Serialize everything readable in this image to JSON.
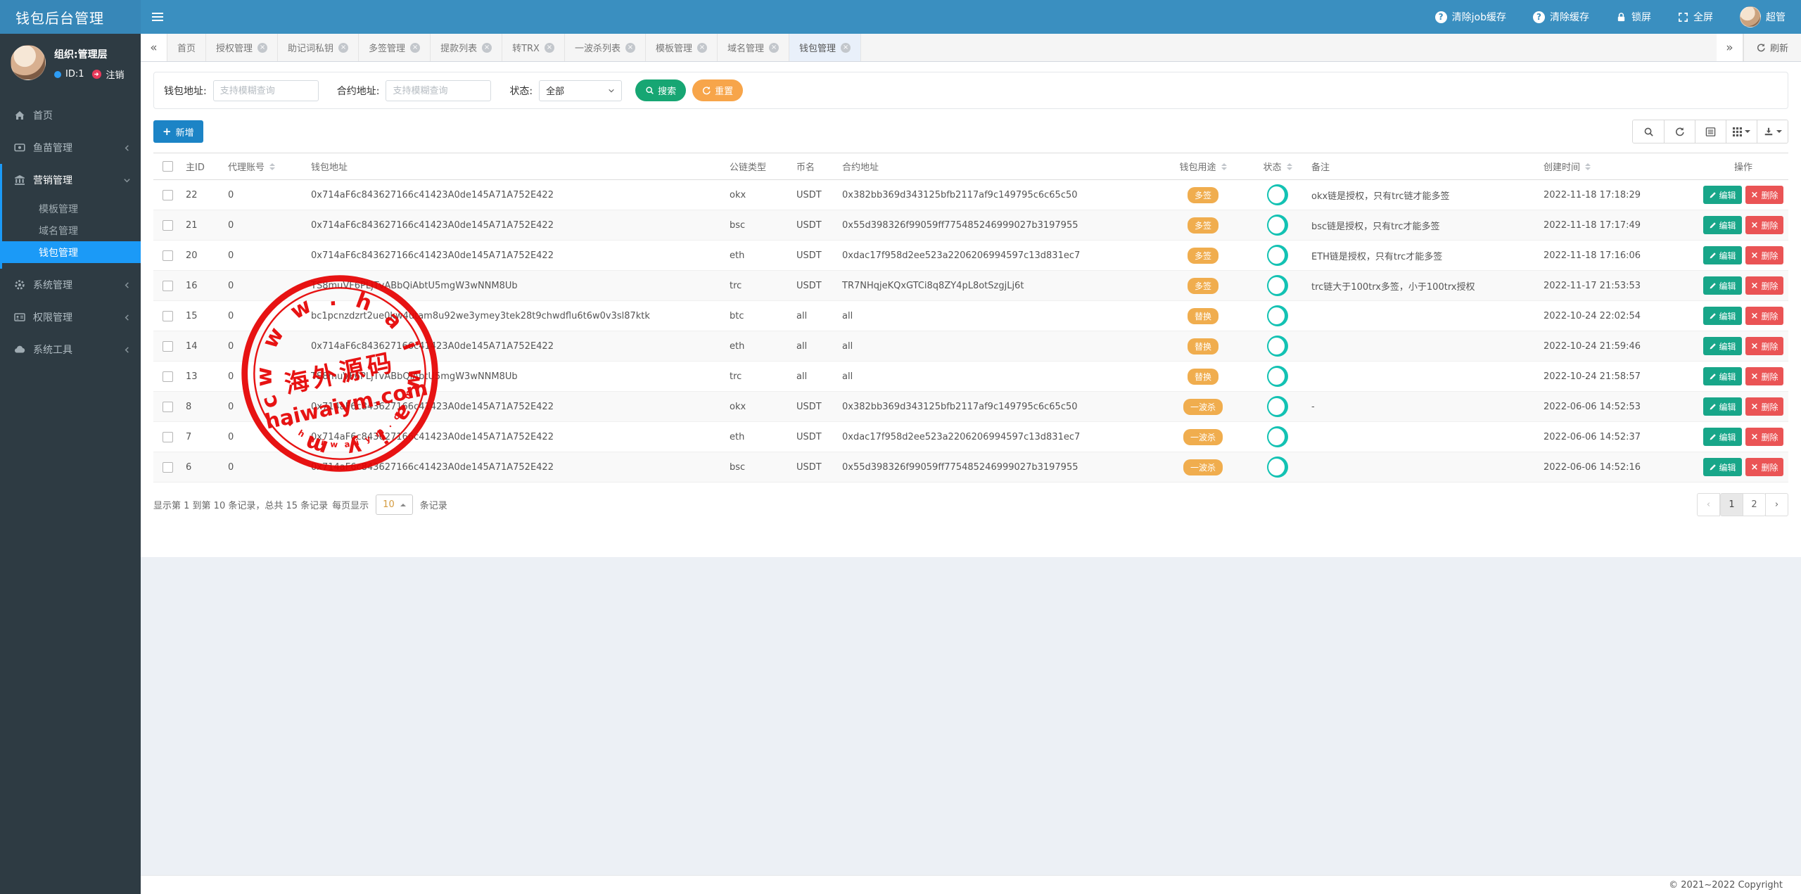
{
  "app": {
    "title": "钱包后台管理"
  },
  "topbar": {
    "actions": [
      {
        "name": "clear-job-cache-button",
        "icon": "question-icon",
        "label": "清除job缓存"
      },
      {
        "name": "clear-cache-button",
        "icon": "question-icon",
        "label": "清除缓存"
      },
      {
        "name": "lock-screen-button",
        "icon": "lock-icon",
        "label": "锁屏"
      },
      {
        "name": "fullscreen-button",
        "icon": "fullscreen-icon",
        "label": "全屏"
      }
    ],
    "user": {
      "label": "超管"
    }
  },
  "tabbar": {
    "scroll_left": "«",
    "scroll_right": "»",
    "refresh_label": "刷新",
    "tabs": [
      {
        "label": "首页",
        "closable": false,
        "active": false
      },
      {
        "label": "授权管理",
        "closable": true,
        "active": false
      },
      {
        "label": "助记词私钥",
        "closable": true,
        "active": false
      },
      {
        "label": "多签管理",
        "closable": true,
        "active": false
      },
      {
        "label": "提款列表",
        "closable": true,
        "active": false
      },
      {
        "label": "转TRX",
        "closable": true,
        "active": false
      },
      {
        "label": "一波杀列表",
        "closable": true,
        "active": false
      },
      {
        "label": "模板管理",
        "closable": true,
        "active": false
      },
      {
        "label": "域名管理",
        "closable": true,
        "active": false
      },
      {
        "label": "钱包管理",
        "closable": true,
        "active": true
      }
    ]
  },
  "sidebar": {
    "user": {
      "org": "组织:管理层",
      "id": "ID:1",
      "logout": "注销"
    },
    "menu": [
      {
        "label": "首页",
        "icon": "home-icon",
        "chevron": null
      },
      {
        "label": "鱼苗管理",
        "icon": "screen-icon",
        "chevron": "left"
      },
      {
        "label": "营销管理",
        "icon": "bank-icon",
        "chevron": "down",
        "active_section": true,
        "children": [
          {
            "label": "模板管理",
            "active": false
          },
          {
            "label": "域名管理",
            "active": false
          },
          {
            "label": "钱包管理",
            "active": true
          }
        ]
      },
      {
        "label": "系统管理",
        "icon": "gear-icon",
        "chevron": "left"
      },
      {
        "label": "权限管理",
        "icon": "idcard-icon",
        "chevron": "left"
      },
      {
        "label": "系统工具",
        "icon": "cloud-icon",
        "chevron": "left"
      }
    ]
  },
  "search": {
    "wallet_label": "钱包地址:",
    "wallet_placeholder": "支持模糊查询",
    "contract_label": "合约地址:",
    "contract_placeholder": "支持模糊查询",
    "status_label": "状态:",
    "status_value": "全部",
    "search_label": "搜索",
    "reset_label": "重置"
  },
  "toolbar": {
    "add_label": "新增",
    "icons": [
      "search-icon",
      "refresh-icon",
      "detail-view-icon",
      "columns-icon",
      "export-icon"
    ]
  },
  "table": {
    "columns": [
      {
        "key": "sel",
        "label": "",
        "checkbox": true
      },
      {
        "key": "id",
        "label": "主ID"
      },
      {
        "key": "agent",
        "label": "代理账号",
        "sortable": true
      },
      {
        "key": "addr",
        "label": "钱包地址"
      },
      {
        "key": "chain",
        "label": "公链类型"
      },
      {
        "key": "coin",
        "label": "币名"
      },
      {
        "key": "contract",
        "label": "合约地址"
      },
      {
        "key": "usage",
        "label": "钱包用途",
        "sortable": true
      },
      {
        "key": "status",
        "label": "状态",
        "sortable": true
      },
      {
        "key": "remark",
        "label": "备注"
      },
      {
        "key": "created",
        "label": "创建时间",
        "sortable": true
      },
      {
        "key": "actions",
        "label": "操作"
      }
    ],
    "actions": {
      "edit_label": "编辑",
      "delete_label": "删除"
    },
    "rows": [
      {
        "id": "22",
        "agent": "0",
        "addr": "0x714aF6c843627166c41423A0de145A71A752E422",
        "chain": "okx",
        "coin": "USDT",
        "contract": "0x382bb369d343125bfb2117af9c149795c6c65c50",
        "usage": "多签",
        "status_on": true,
        "remark": "okx链是授权，只有trc链才能多签",
        "created": "2022-11-18 17:18:29"
      },
      {
        "id": "21",
        "agent": "0",
        "addr": "0x714aF6c843627166c41423A0de145A71A752E422",
        "chain": "bsc",
        "coin": "USDT",
        "contract": "0x55d398326f99059ff775485246999027b3197955",
        "usage": "多签",
        "status_on": true,
        "remark": "bsc链是授权，只有trc才能多签",
        "created": "2022-11-18 17:17:49"
      },
      {
        "id": "20",
        "agent": "0",
        "addr": "0x714aF6c843627166c41423A0de145A71A752E422",
        "chain": "eth",
        "coin": "USDT",
        "contract": "0xdac17f958d2ee523a2206206994597c13d831ec7",
        "usage": "多签",
        "status_on": true,
        "remark": "ETH链是授权，只有trc才能多签",
        "created": "2022-11-18 17:16:06"
      },
      {
        "id": "16",
        "agent": "0",
        "addr": "TS8muVF6PLjTvABbQiAbtU5mgW3wNNM8Ub",
        "chain": "trc",
        "coin": "USDT",
        "contract": "TR7NHqjeKQxGTCi8q8ZY4pL8otSzgjLj6t",
        "usage": "多签",
        "status_on": true,
        "remark": "trc链大于100trx多签，小于100trx授权",
        "created": "2022-11-17 21:53:53"
      },
      {
        "id": "15",
        "agent": "0",
        "addr": "bc1pcnzdzrt2ue0kw4utam8u92we3ymey3tek28t9chwdflu6t6w0v3sl87ktk",
        "chain": "btc",
        "coin": "all",
        "contract": "all",
        "usage": "替换",
        "status_on": true,
        "remark": "",
        "created": "2022-10-24 22:02:54"
      },
      {
        "id": "14",
        "agent": "0",
        "addr": "0x714aF6c843627166c41423A0de145A71A752E422",
        "chain": "eth",
        "coin": "all",
        "contract": "all",
        "usage": "替换",
        "status_on": true,
        "remark": "",
        "created": "2022-10-24 21:59:46"
      },
      {
        "id": "13",
        "agent": "0",
        "addr": "TS8muVF6PLjTvABbQiAbtU5mgW3wNNM8Ub",
        "chain": "trc",
        "coin": "all",
        "contract": "all",
        "usage": "替换",
        "status_on": true,
        "remark": "",
        "created": "2022-10-24 21:58:57"
      },
      {
        "id": "8",
        "agent": "0",
        "addr": "0x714aF6c843627166c41423A0de145A71A752E422",
        "chain": "okx",
        "coin": "USDT",
        "contract": "0x382bb369d343125bfb2117af9c149795c6c65c50",
        "usage": "一波杀",
        "status_on": true,
        "remark": "-",
        "created": "2022-06-06 14:52:53"
      },
      {
        "id": "7",
        "agent": "0",
        "addr": "0x714aF6c843627166c41423A0de145A71A752E422",
        "chain": "eth",
        "coin": "USDT",
        "contract": "0xdac17f958d2ee523a2206206994597c13d831ec7",
        "usage": "一波杀",
        "status_on": true,
        "remark": "",
        "created": "2022-06-06 14:52:37"
      },
      {
        "id": "6",
        "agent": "0",
        "addr": "0x714aF6c843627166c41423A0de145A71A752E422",
        "chain": "bsc",
        "coin": "USDT",
        "contract": "0x55d398326f99059ff775485246999027b3197955",
        "usage": "一波杀",
        "status_on": true,
        "remark": "",
        "created": "2022-06-06 14:52:16"
      }
    ]
  },
  "pagination": {
    "info": "显示第 1 到第 10 条记录，总共 15 条记录",
    "per_page_prefix": "每页显示",
    "per_page": "10",
    "per_page_suffix": "条记录",
    "prev": "‹",
    "next": "›",
    "pages": [
      {
        "label": "1",
        "active": true
      },
      {
        "label": "2",
        "active": false
      }
    ]
  },
  "footer": {
    "copyright": "© 2021~2022 Copyright"
  },
  "watermark": {
    "center_text": "海外源码",
    "domain_text": "haiwaiym.com",
    "ring_text": "w w w . h a i w a i y m . c o m",
    "arc_text": "h a i w a i y m . c o m"
  },
  "colors": {
    "navbar": "#3a8fc0",
    "logo_bg": "#3787b8",
    "sidebar": "#2e3b43",
    "active_blue": "#1b9af7",
    "primary_btn": "#1c84c6",
    "search_green": "#17a673",
    "reset_orange": "#f7a54a",
    "badge_orange": "#f0ad4e",
    "toggle_teal": "#13c2b3",
    "edit_green": "#18a689",
    "delete_red": "#ea5455",
    "stamp_red": "#e60000"
  }
}
